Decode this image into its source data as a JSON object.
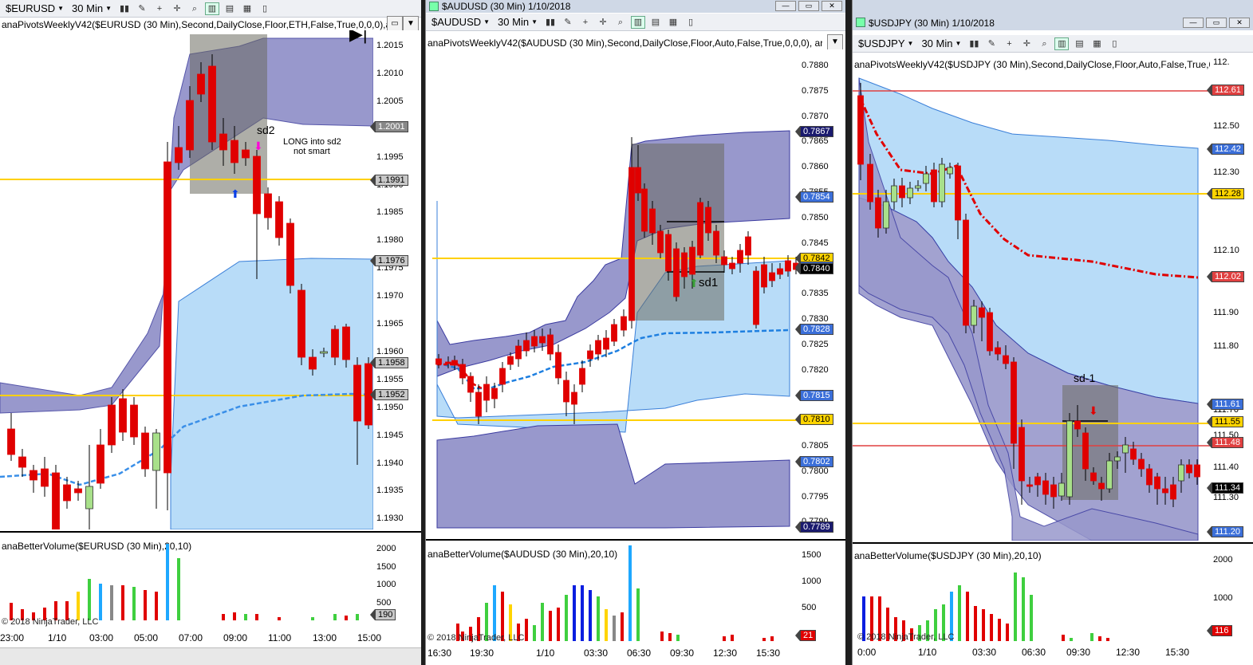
{
  "w1": {
    "symbol": "$EURUSD",
    "interval": "30 Min",
    "indicator": "anaPivotsWeeklyV42($EURUSD (30 Min),Second,DailyClose,Floor,ETH,False,True,0,0,0),anaP",
    "volume_label": "anaBetterVolume($EURUSD (30 Min),20,10)",
    "annotation_sd": "sd2",
    "annotation_note_1": "LONG into sd2",
    "annotation_note_2": "not smart",
    "copyright": "2018 NinjaTrader, LLC",
    "volume_tag": "190",
    "y_ticks": [
      "1.2015",
      "1.2010",
      "1.2005",
      "1.2000",
      "1.1995",
      "1.1990",
      "1.1985",
      "1.1980",
      "1.1975",
      "1.1970",
      "1.1965",
      "1.1960",
      "1.1955",
      "1.1950",
      "1.1945",
      "1.1940",
      "1.1935",
      "1.1930"
    ],
    "vol_ticks": [
      "2000",
      "1500",
      "1000",
      "500"
    ],
    "tags": [
      {
        "v": "1.2001",
        "bg": "#888888",
        "fg": "#ffffff"
      },
      {
        "v": "1.1991",
        "bg": "#c8c8c8",
        "fg": "#000000"
      },
      {
        "v": "1.1976",
        "bg": "#c8c8c8",
        "fg": "#000000"
      },
      {
        "v": "1.1958",
        "bg": "#c8c8c8",
        "fg": "#000000"
      },
      {
        "v": "1.1952",
        "bg": "#c8c8c8",
        "fg": "#000000"
      }
    ],
    "x_labels": [
      "23:00",
      "1/10",
      "03:00",
      "05:00",
      "07:00",
      "09:00",
      "11:00",
      "13:00",
      "15:00"
    ]
  },
  "w2": {
    "title": "$AUDUSD (30 Min)  1/10/2018",
    "symbol": "$AUDUSD",
    "interval": "30 Min",
    "indicator": "anaPivotsWeeklyV42($AUDUSD (30 Min),Second,DailyClose,Floor,Auto,False,True,0,0,0), ar",
    "volume_label": "anaBetterVolume($AUDUSD (30 Min),20,10)",
    "annotation_sd": "sd1",
    "copyright": "2018 NinjaTrader, LLC",
    "volume_tag": "21",
    "y_ticks": [
      "0.7880",
      "0.7875",
      "0.7870",
      "0.7865",
      "0.7860",
      "0.7855",
      "0.7850",
      "0.7845",
      "0.7840",
      "0.7835",
      "0.7830",
      "0.7825",
      "0.7820",
      "0.7815",
      "0.7810",
      "0.7805",
      "0.7800",
      "0.7795",
      "0.7790"
    ],
    "vol_ticks": [
      "1500",
      "1000",
      "500"
    ],
    "tags": [
      {
        "v": "0.7867",
        "bg": "#1a1a6e",
        "fg": "#ffffff"
      },
      {
        "v": "0.7854",
        "bg": "#3b6fd9",
        "fg": "#ffffff"
      },
      {
        "v": "0.7842",
        "bg": "#ffd400",
        "fg": "#000000"
      },
      {
        "v": "0.7841",
        "bg": "#3b6fd9",
        "fg": "#ffffff"
      },
      {
        "v": "0.7840",
        "bg": "#000000",
        "fg": "#ffffff"
      },
      {
        "v": "0.7828",
        "bg": "#3b6fd9",
        "fg": "#ffffff"
      },
      {
        "v": "0.7815",
        "bg": "#3b6fd9",
        "fg": "#ffffff"
      },
      {
        "v": "0.7810",
        "bg": "#ffd400",
        "fg": "#000000"
      },
      {
        "v": "0.7802",
        "bg": "#3b6fd9",
        "fg": "#ffffff"
      },
      {
        "v": "0.7789",
        "bg": "#1a1a6e",
        "fg": "#ffffff"
      }
    ],
    "x_labels": [
      "16:30",
      "19:30",
      "1/10",
      "03:30",
      "06:30",
      "09:30",
      "12:30",
      "15:30"
    ]
  },
  "w3": {
    "title": "$USDJPY (30 Min)  1/10/2018",
    "symbol": "$USDJPY",
    "interval": "30 Min",
    "indicator": "anaPivotsWeeklyV42($USDJPY (30 Min),Second,DailyClose,Floor,Auto,False,True,0,0,0,",
    "volume_label": "anaBetterVolume($USDJPY (30 Min),20,10)",
    "annotation_sd": "sd-1",
    "copyright": "2018 NinjaTrader, LLC",
    "volume_tag": "116",
    "top_tick": "112.",
    "y_ticks": [
      "112.50",
      "112.30",
      "112.10",
      "111.90",
      "111.80",
      "111.70",
      "111.50",
      "111.40",
      "111.30"
    ],
    "vol_ticks": [
      "2000",
      "1000"
    ],
    "tags": [
      {
        "v": "112.61",
        "bg": "#e04040",
        "fg": "#ffffff"
      },
      {
        "v": "112.42",
        "bg": "#3b6fd9",
        "fg": "#ffffff"
      },
      {
        "v": "112.28",
        "bg": "#ffd400",
        "fg": "#000000"
      },
      {
        "v": "112.02",
        "bg": "#e04040",
        "fg": "#ffffff"
      },
      {
        "v": "111.61",
        "bg": "#3b6fd9",
        "fg": "#ffffff"
      },
      {
        "v": "111.55",
        "bg": "#ffd400",
        "fg": "#000000"
      },
      {
        "v": "111.48",
        "bg": "#e04040",
        "fg": "#ffffff"
      },
      {
        "v": "111.34",
        "bg": "#000000",
        "fg": "#ffffff"
      },
      {
        "v": "111.20",
        "bg": "#3b6fd9",
        "fg": "#ffffff"
      }
    ],
    "x_labels": [
      "0:00",
      "1/10",
      "03:30",
      "06:30",
      "09:30",
      "12:30",
      "15:30"
    ]
  },
  "colors": {
    "up": "#a8e08a",
    "down": "#e00000",
    "band_light": "#b8dcf8",
    "band_dark": "#9898cc",
    "pivot": "#ffd000",
    "bullbox": "#a0a878"
  }
}
